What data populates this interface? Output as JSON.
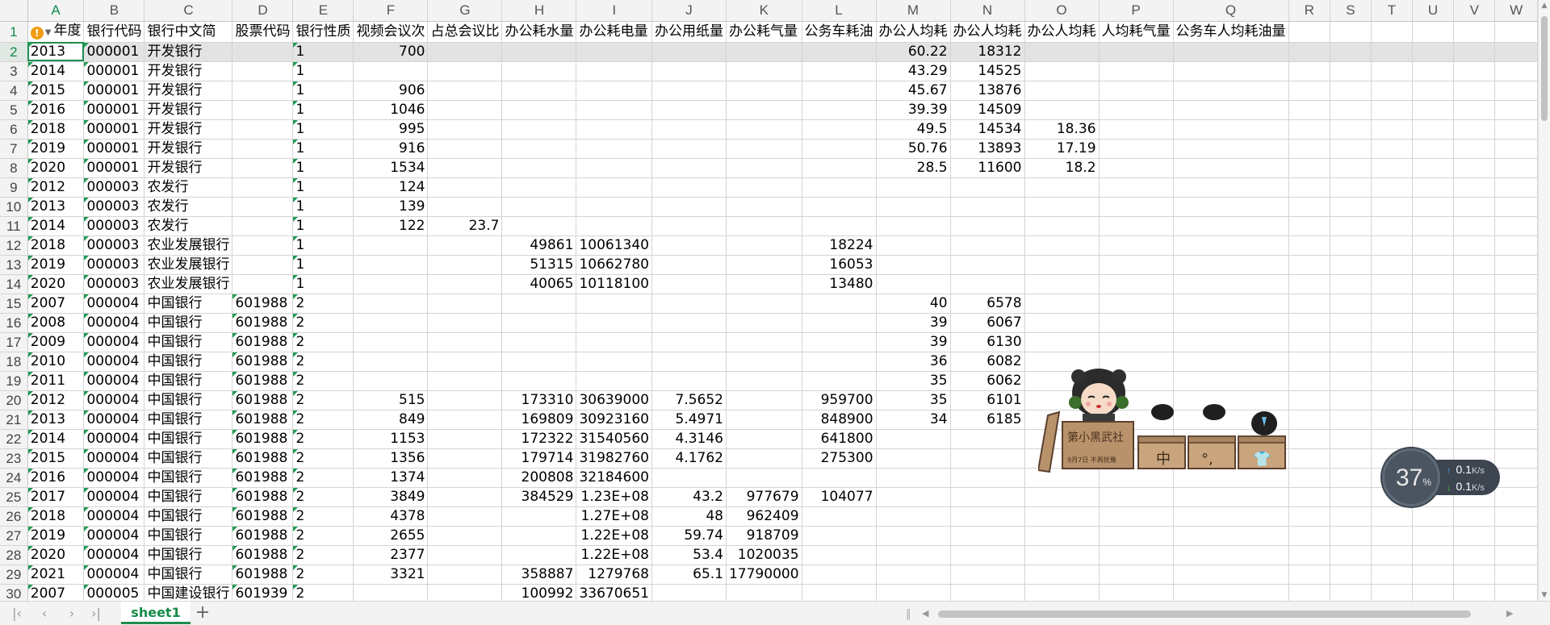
{
  "columns": [
    "A",
    "B",
    "C",
    "D",
    "E",
    "F",
    "G",
    "H",
    "I",
    "J",
    "K",
    "L",
    "M",
    "N",
    "O",
    "P",
    "Q",
    "R",
    "S",
    "T",
    "U",
    "V",
    "W"
  ],
  "selected_column": "A",
  "warning_icon": "exclamation-icon",
  "header_row": [
    "年度",
    "银行代码",
    "银行中文简",
    "股票代码",
    "银行性质",
    "视频会议次",
    "占总会议比",
    "办公耗水量",
    "办公耗电量",
    "办公用纸量",
    "办公耗气量",
    "公务车耗油",
    "办公人均耗",
    "办公人均耗",
    "办公人均耗",
    "人均耗气量",
    "公务车人均耗油量",
    "",
    "",
    "",
    "",
    "",
    ""
  ],
  "rows": [
    {
      "n": "2",
      "c": [
        "2013",
        "000001",
        "开发银行",
        "",
        "1",
        "700",
        "",
        "",
        "",
        "",
        "",
        "",
        "60.22",
        "18312",
        "",
        "",
        "",
        "",
        "",
        "",
        "",
        "",
        ""
      ]
    },
    {
      "n": "3",
      "c": [
        "2014",
        "000001",
        "开发银行",
        "",
        "1",
        "",
        "",
        "",
        "",
        "",
        "",
        "",
        "43.29",
        "14525",
        "",
        "",
        "",
        "",
        "",
        "",
        "",
        "",
        ""
      ]
    },
    {
      "n": "4",
      "c": [
        "2015",
        "000001",
        "开发银行",
        "",
        "1",
        "906",
        "",
        "",
        "",
        "",
        "",
        "",
        "45.67",
        "13876",
        "",
        "",
        "",
        "",
        "",
        "",
        "",
        "",
        ""
      ]
    },
    {
      "n": "5",
      "c": [
        "2016",
        "000001",
        "开发银行",
        "",
        "1",
        "1046",
        "",
        "",
        "",
        "",
        "",
        "",
        "39.39",
        "14509",
        "",
        "",
        "",
        "",
        "",
        "",
        "",
        "",
        ""
      ]
    },
    {
      "n": "6",
      "c": [
        "2018",
        "000001",
        "开发银行",
        "",
        "1",
        "995",
        "",
        "",
        "",
        "",
        "",
        "",
        "49.5",
        "14534",
        "18.36",
        "",
        "",
        "",
        "",
        "",
        "",
        "",
        ""
      ]
    },
    {
      "n": "7",
      "c": [
        "2019",
        "000001",
        "开发银行",
        "",
        "1",
        "916",
        "",
        "",
        "",
        "",
        "",
        "",
        "50.76",
        "13893",
        "17.19",
        "",
        "",
        "",
        "",
        "",
        "",
        "",
        ""
      ]
    },
    {
      "n": "8",
      "c": [
        "2020",
        "000001",
        "开发银行",
        "",
        "1",
        "1534",
        "",
        "",
        "",
        "",
        "",
        "",
        "28.5",
        "11600",
        "18.2",
        "",
        "",
        "",
        "",
        "",
        "",
        "",
        ""
      ]
    },
    {
      "n": "9",
      "c": [
        "2012",
        "000003",
        "农发行",
        "",
        "1",
        "124",
        "",
        "",
        "",
        "",
        "",
        "",
        "",
        "",
        "",
        "",
        "",
        "",
        "",
        "",
        "",
        "",
        ""
      ]
    },
    {
      "n": "10",
      "c": [
        "2013",
        "000003",
        "农发行",
        "",
        "1",
        "139",
        "",
        "",
        "",
        "",
        "",
        "",
        "",
        "",
        "",
        "",
        "",
        "",
        "",
        "",
        "",
        "",
        ""
      ]
    },
    {
      "n": "11",
      "c": [
        "2014",
        "000003",
        "农发行",
        "",
        "1",
        "122",
        "23.7",
        "",
        "",
        "",
        "",
        "",
        "",
        "",
        "",
        "",
        "",
        "",
        "",
        "",
        "",
        "",
        ""
      ]
    },
    {
      "n": "12",
      "c": [
        "2018",
        "000003",
        "农业发展银行",
        "",
        "1",
        "",
        "",
        "49861",
        "10061340",
        "",
        "",
        "18224",
        "",
        "",
        "",
        "",
        "",
        "",
        "",
        "",
        "",
        "",
        ""
      ]
    },
    {
      "n": "13",
      "c": [
        "2019",
        "000003",
        "农业发展银行",
        "",
        "1",
        "",
        "",
        "51315",
        "10662780",
        "",
        "",
        "16053",
        "",
        "",
        "",
        "",
        "",
        "",
        "",
        "",
        "",
        "",
        ""
      ]
    },
    {
      "n": "14",
      "c": [
        "2020",
        "000003",
        "农业发展银行",
        "",
        "1",
        "",
        "",
        "40065",
        "10118100",
        "",
        "",
        "13480",
        "",
        "",
        "",
        "",
        "",
        "",
        "",
        "",
        "",
        "",
        ""
      ]
    },
    {
      "n": "15",
      "c": [
        "2007",
        "000004",
        "中国银行",
        "601988",
        "2",
        "",
        "",
        "",
        "",
        "",
        "",
        "",
        "40",
        "6578",
        "",
        "",
        "",
        "",
        "",
        "",
        "",
        "",
        ""
      ]
    },
    {
      "n": "16",
      "c": [
        "2008",
        "000004",
        "中国银行",
        "601988",
        "2",
        "",
        "",
        "",
        "",
        "",
        "",
        "",
        "39",
        "6067",
        "",
        "",
        "",
        "",
        "",
        "",
        "",
        "",
        ""
      ]
    },
    {
      "n": "17",
      "c": [
        "2009",
        "000004",
        "中国银行",
        "601988",
        "2",
        "",
        "",
        "",
        "",
        "",
        "",
        "",
        "39",
        "6130",
        "",
        "",
        "",
        "",
        "",
        "",
        "",
        "",
        ""
      ]
    },
    {
      "n": "18",
      "c": [
        "2010",
        "000004",
        "中国银行",
        "601988",
        "2",
        "",
        "",
        "",
        "",
        "",
        "",
        "",
        "36",
        "6082",
        "",
        "",
        "",
        "",
        "",
        "",
        "",
        "",
        ""
      ]
    },
    {
      "n": "19",
      "c": [
        "2011",
        "000004",
        "中国银行",
        "601988",
        "2",
        "",
        "",
        "",
        "",
        "",
        "",
        "",
        "35",
        "6062",
        "",
        "",
        "",
        "",
        "",
        "",
        "",
        "",
        ""
      ]
    },
    {
      "n": "20",
      "c": [
        "2012",
        "000004",
        "中国银行",
        "601988",
        "2",
        "515",
        "",
        "173310",
        "30639000",
        "7.5652",
        "",
        "959700",
        "35",
        "6101",
        "",
        "",
        "",
        "",
        "",
        "",
        "",
        "",
        ""
      ]
    },
    {
      "n": "21",
      "c": [
        "2013",
        "000004",
        "中国银行",
        "601988",
        "2",
        "849",
        "",
        "169809",
        "30923160",
        "5.4971",
        "",
        "848900",
        "34",
        "6185",
        "",
        "",
        "",
        "",
        "",
        "",
        "",
        "",
        ""
      ]
    },
    {
      "n": "22",
      "c": [
        "2014",
        "000004",
        "中国银行",
        "601988",
        "2",
        "1153",
        "",
        "172322",
        "31540560",
        "4.3146",
        "",
        "641800",
        "",
        "",
        "",
        "",
        "",
        "",
        "",
        "",
        "",
        "",
        ""
      ]
    },
    {
      "n": "23",
      "c": [
        "2015",
        "000004",
        "中国银行",
        "601988",
        "2",
        "1356",
        "",
        "179714",
        "31982760",
        "4.1762",
        "",
        "275300",
        "",
        "",
        "",
        "",
        "",
        "",
        "",
        "",
        "",
        "",
        ""
      ]
    },
    {
      "n": "24",
      "c": [
        "2016",
        "000004",
        "中国银行",
        "601988",
        "2",
        "1374",
        "",
        "200808",
        "32184600",
        "",
        "",
        "",
        "",
        "",
        "",
        "",
        "",
        "",
        "",
        "",
        "",
        "",
        ""
      ]
    },
    {
      "n": "25",
      "c": [
        "2017",
        "000004",
        "中国银行",
        "601988",
        "2",
        "3849",
        "",
        "384529",
        "1.23E+08",
        "43.2",
        "977679",
        "104077",
        "",
        "",
        "",
        "",
        "",
        "",
        "",
        "",
        "",
        "",
        ""
      ]
    },
    {
      "n": "26",
      "c": [
        "2018",
        "000004",
        "中国银行",
        "601988",
        "2",
        "4378",
        "",
        "",
        "1.27E+08",
        "48",
        "962409",
        "",
        "",
        "",
        "",
        "",
        "",
        "",
        "",
        "",
        "",
        "",
        ""
      ]
    },
    {
      "n": "27",
      "c": [
        "2019",
        "000004",
        "中国银行",
        "601988",
        "2",
        "2655",
        "",
        "",
        "1.22E+08",
        "59.74",
        "918709",
        "",
        "",
        "",
        "",
        "",
        "",
        "",
        "",
        "",
        "",
        "",
        ""
      ]
    },
    {
      "n": "28",
      "c": [
        "2020",
        "000004",
        "中国银行",
        "601988",
        "2",
        "2377",
        "",
        "",
        "1.22E+08",
        "53.4",
        "1020035",
        "",
        "",
        "",
        "",
        "",
        "",
        "",
        "",
        "",
        "",
        "",
        ""
      ]
    },
    {
      "n": "29",
      "c": [
        "2021",
        "000004",
        "中国银行",
        "601988",
        "2",
        "3321",
        "",
        "358887",
        "1279768",
        "65.1",
        "17790000",
        "",
        "",
        "",
        "",
        "",
        "",
        "",
        "",
        "",
        "",
        "",
        ""
      ]
    },
    {
      "n": "30",
      "c": [
        "2007",
        "000005",
        "中国建设银行",
        "601939",
        "2",
        "",
        "",
        "100992",
        "33670651",
        "",
        "",
        "",
        "",
        "",
        "",
        "",
        "",
        "",
        "",
        "",
        "",
        "",
        ""
      ]
    }
  ],
  "sheet_tab": "sheet1",
  "add_sheet_label": "+",
  "nav": {
    "first": "|‹",
    "prev": "‹",
    "next": "›",
    "last": "›|"
  },
  "mascot_text": {
    "plaque": "第小黑武社",
    "date": "9月7日 不再犹豫",
    "box1": "中",
    "box2": "°,",
    "box3": "👕"
  },
  "net_widget": {
    "percent": "37",
    "percent_unit": "%",
    "upload": "0.1",
    "download": "0.1",
    "unit": "K/s"
  },
  "colors": {
    "accent": "#1e8d4f",
    "warning": "#f39c12"
  }
}
